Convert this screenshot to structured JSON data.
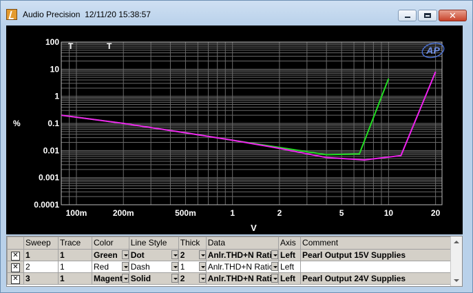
{
  "window": {
    "title": "Audio Precision",
    "timestamp": "12/11/20 15:38:57",
    "icon": "ap-app-icon",
    "controls": [
      "minimize-icon",
      "maximize-icon",
      "close-icon"
    ],
    "close_glyph": "✕"
  },
  "graph": {
    "background": "#000000",
    "markers": [
      "T",
      "T"
    ],
    "logo": "AP"
  },
  "chart_data": {
    "type": "line",
    "xlabel": "V",
    "ylabel": "%",
    "xscale": "log",
    "yscale": "log",
    "xlim": [
      0.08,
      22
    ],
    "ylim": [
      0.0001,
      100
    ],
    "xticks": [
      {
        "value": 0.1,
        "label": "100m"
      },
      {
        "value": 0.2,
        "label": "200m"
      },
      {
        "value": 0.5,
        "label": "500m"
      },
      {
        "value": 1,
        "label": "1"
      },
      {
        "value": 2,
        "label": "2"
      },
      {
        "value": 5,
        "label": "5"
      },
      {
        "value": 10,
        "label": "10"
      },
      {
        "value": 20,
        "label": "20"
      }
    ],
    "yticks": [
      {
        "value": 100,
        "label": "100"
      },
      {
        "value": 10,
        "label": "10"
      },
      {
        "value": 1,
        "label": "1"
      },
      {
        "value": 0.1,
        "label": "0.1"
      },
      {
        "value": 0.01,
        "label": "0.01"
      },
      {
        "value": 0.001,
        "label": "0.001"
      },
      {
        "value": 0.0001,
        "label": "0.0001"
      }
    ],
    "grid": true,
    "series": [
      {
        "name": "Pearl Output 15V Supplies",
        "color": "#22dd22",
        "x": [
          0.08,
          0.2,
          0.5,
          1,
          2,
          4,
          6.5,
          10
        ],
        "y": [
          0.2,
          0.1,
          0.045,
          0.024,
          0.013,
          0.007,
          0.0075,
          4.5
        ]
      },
      {
        "name": "Pearl Output 24V Supplies",
        "color": "#ee22ee",
        "x": [
          0.08,
          0.2,
          0.5,
          1,
          2,
          4,
          7,
          12,
          20
        ],
        "y": [
          0.2,
          0.1,
          0.045,
          0.024,
          0.012,
          0.0055,
          0.0045,
          0.0065,
          8
        ]
      }
    ]
  },
  "table": {
    "headers": [
      "Sweep",
      "Trace",
      "Color",
      "Line Style",
      "Thick",
      "Data",
      "Axis",
      "Comment"
    ],
    "rows": [
      {
        "checked": "✕",
        "sweep": "1",
        "trace": "1",
        "color": "Green",
        "style": "Dot",
        "thick": "2",
        "data": "Anlr.THD+N Ratio",
        "axis": "Left",
        "comment": "Pearl Output 15V Supplies"
      },
      {
        "checked": "✕",
        "sweep": "2",
        "trace": "1",
        "color": "Red",
        "style": "Dash",
        "thick": "1",
        "data": "Anlr.THD+N Ratio",
        "axis": "Left",
        "comment": ""
      },
      {
        "checked": "✕",
        "sweep": "3",
        "trace": "1",
        "color": "Magenta",
        "style": "Solid",
        "thick": "2",
        "data": "Anlr.THD+N Ratio",
        "axis": "Left",
        "comment": "Pearl Output 24V Supplies"
      }
    ]
  }
}
